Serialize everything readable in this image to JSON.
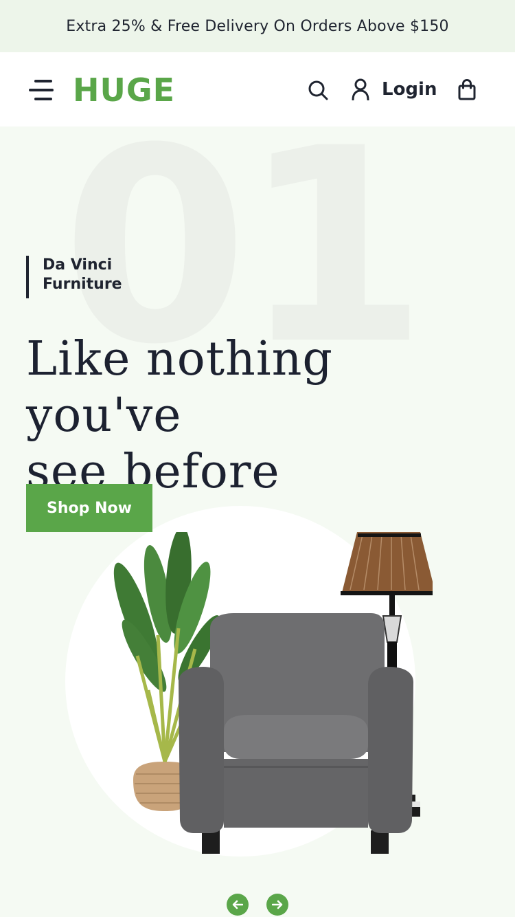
{
  "promo": {
    "text": "Extra 25% & Free Delivery On Orders Above $150"
  },
  "header": {
    "logo": "HUGE",
    "login_label": "Login",
    "icons": [
      "menu-icon",
      "search-icon",
      "user-icon",
      "shopping-bag-icon"
    ]
  },
  "hero": {
    "slide_number": "01",
    "subtitle_line1": "Da Vinci",
    "subtitle_line2": "Furniture",
    "headline_line1": "Like nothing you've",
    "headline_line2": "see before",
    "cta_label": "Shop Now"
  },
  "carousel": {
    "prev_icon": "arrow-left-icon",
    "next_icon": "arrow-right-icon"
  },
  "colors": {
    "brand_green": "#5aa649",
    "text_dark": "#1f2430",
    "promo_bg": "#edf5ea",
    "hero_bg": "#f5faf3"
  }
}
